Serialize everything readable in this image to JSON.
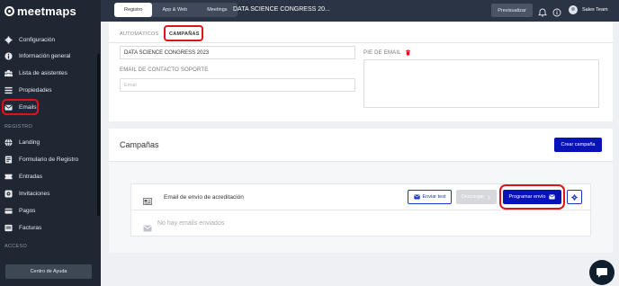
{
  "brand": {
    "name": "meetmaps"
  },
  "sidebar": {
    "items": [
      {
        "label": "Configuración",
        "icon": "gear-icon"
      },
      {
        "label": "Información general",
        "icon": "info-icon"
      },
      {
        "label": "Lista de asistentes",
        "icon": "users-icon"
      },
      {
        "label": "Propiedades",
        "icon": "list-icon"
      },
      {
        "label": "Emails",
        "icon": "envelope-icon"
      }
    ],
    "section_registro": "REGISTRO",
    "registro_items": [
      {
        "label": "Landing",
        "icon": "globe-icon"
      },
      {
        "label": "Formulario de Registro",
        "icon": "form-icon"
      },
      {
        "label": "Entradas",
        "icon": "ticket-icon"
      },
      {
        "label": "Invitaciones",
        "icon": "invitation-icon"
      },
      {
        "label": "Pagos",
        "icon": "card-icon"
      },
      {
        "label": "Facturas",
        "icon": "invoice-icon"
      }
    ],
    "section_acceso": "ACCESO",
    "help_button": "Centro de Ayuda"
  },
  "topbar": {
    "tabs": [
      {
        "label": "Registro",
        "active": true
      },
      {
        "label": "App & Web",
        "active": false
      },
      {
        "label": "Meetings",
        "active": false
      }
    ],
    "event_name": "DATA SCIENCE CONGRESS 20...",
    "preview_button": "Previsualizar",
    "team_name": "Sales Team"
  },
  "tabs": {
    "automaticos": "AUTOMÁTICOS",
    "campanas": "CAMPAÑAS"
  },
  "form": {
    "title_value": "DATA SCIENCE CONGRESS 2023",
    "email_label": "EMAIL DE CONTACTO SOPORTE",
    "email_placeholder": "Email",
    "footer_label": "PIE DE EMAIL"
  },
  "campaigns": {
    "title": "Campañas",
    "create_button": "Crear campaña",
    "row": {
      "name": "Email de envío de acreditación",
      "test_button": "Enviar test",
      "download_button": "Descargar",
      "schedule_button": "Programar envío"
    },
    "empty_text": "No hay emails enviados"
  },
  "colors": {
    "sidebar_bg": "#1f2733",
    "topbar_bg": "#2b3445",
    "primary": "#0713b8",
    "highlight": "#e0131c"
  }
}
